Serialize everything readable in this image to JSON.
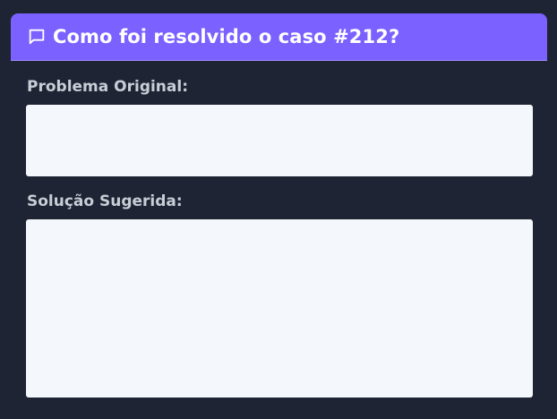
{
  "card": {
    "icon": "chat-bubble-icon",
    "title": "Como foi resolvido o caso #212?"
  },
  "fields": [
    {
      "label": "Problema Original:",
      "value": ""
    },
    {
      "label": "Solução Sugerida:",
      "value": ""
    }
  ],
  "colors": {
    "background": "#1e2433",
    "header": "#7b61ff",
    "field": "#f4f8fc",
    "label": "#c9cdd6"
  }
}
